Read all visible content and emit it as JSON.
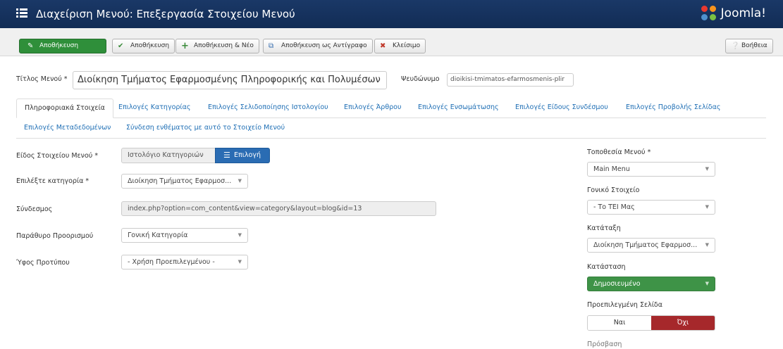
{
  "header": {
    "title": "Διαχείριση Μενού: Επεξεργασία Στοιχείου Μενού",
    "brand": "Joomla!"
  },
  "toolbar": {
    "save_label": "Αποθήκευση",
    "save_close_label": "Αποθήκευση",
    "save_new_label": "Αποθήκευση & Νέο",
    "save_copy_label": "Αποθήκευση ως Αντίγραφο",
    "close_label": "Κλείσιμο",
    "help_label": "Βοήθεια"
  },
  "title_row": {
    "title_label": "Τίτλος Μενού *",
    "title_value": "Διοίκηση Τμήματος Εφαρμοσμένης Πληροφορικής και Πολυμέσων",
    "alias_label": "Ψευδώνυμο",
    "alias_value": "dioikisi-tmimatos-efarmosmenis-plir"
  },
  "tabs": [
    {
      "label": "Πληροφοριακά Στοιχεία"
    },
    {
      "label": "Επιλογές Κατηγορίας"
    },
    {
      "label": "Επιλογές Σελιδοποίησης Ιστολογίου"
    },
    {
      "label": "Επιλογές Άρθρου"
    },
    {
      "label": "Επιλογές Ενσωμάτωσης"
    },
    {
      "label": "Επιλογές Είδους Συνδέσμου"
    },
    {
      "label": "Επιλογές Προβολής Σελίδας"
    },
    {
      "label": "Επιλογές Μεταδεδομένων"
    },
    {
      "label": "Σύνδεση ενθέματος με αυτό το Στοιχείο Μενού"
    }
  ],
  "form": {
    "type_label": "Είδος Στοιχείου Μενού *",
    "type_value": "Ιστολόγιο Κατηγοριών",
    "select_button": "Επιλογή",
    "category_label": "Επιλέξτε κατηγορία *",
    "category_value": "Διοίκηση Τμήματος Εφαρμοσ...",
    "link_label": "Σύνδεσμος",
    "link_value": "index.php?option=com_content&view=category&layout=blog&id=13",
    "target_label": "Παράθυρο Προορισμού",
    "target_value": "Γονική Κατηγορία",
    "style_label": "Ύφος Προτύπου",
    "style_value": "- Χρήση Προεπιλεγμένου -"
  },
  "sidebar": {
    "menu_location_label": "Τοποθεσία Μενού *",
    "menu_location_value": "Main Menu",
    "parent_label": "Γονικό Στοιχείο",
    "parent_value": "- Το ΤΕΙ Μας",
    "ordering_label": "Κατάταξη",
    "ordering_value": "Διοίκηση Τμήματος Εφαρμοσ...",
    "status_label": "Κατάσταση",
    "status_value": "Δημοσιευμένο",
    "default_page_label": "Προεπιλεγμένη Σελίδα",
    "default_yes": "Ναι",
    "default_no": "Όχι",
    "access_label": "Πρόσβαση"
  },
  "colors": {
    "header_bg": "#1a3867",
    "primary_green": "#2f8f3a",
    "select_blue": "#2a6cb3",
    "status_green": "#3e9347",
    "no_red": "#a6282b",
    "tab_link": "#1f6fb5"
  }
}
